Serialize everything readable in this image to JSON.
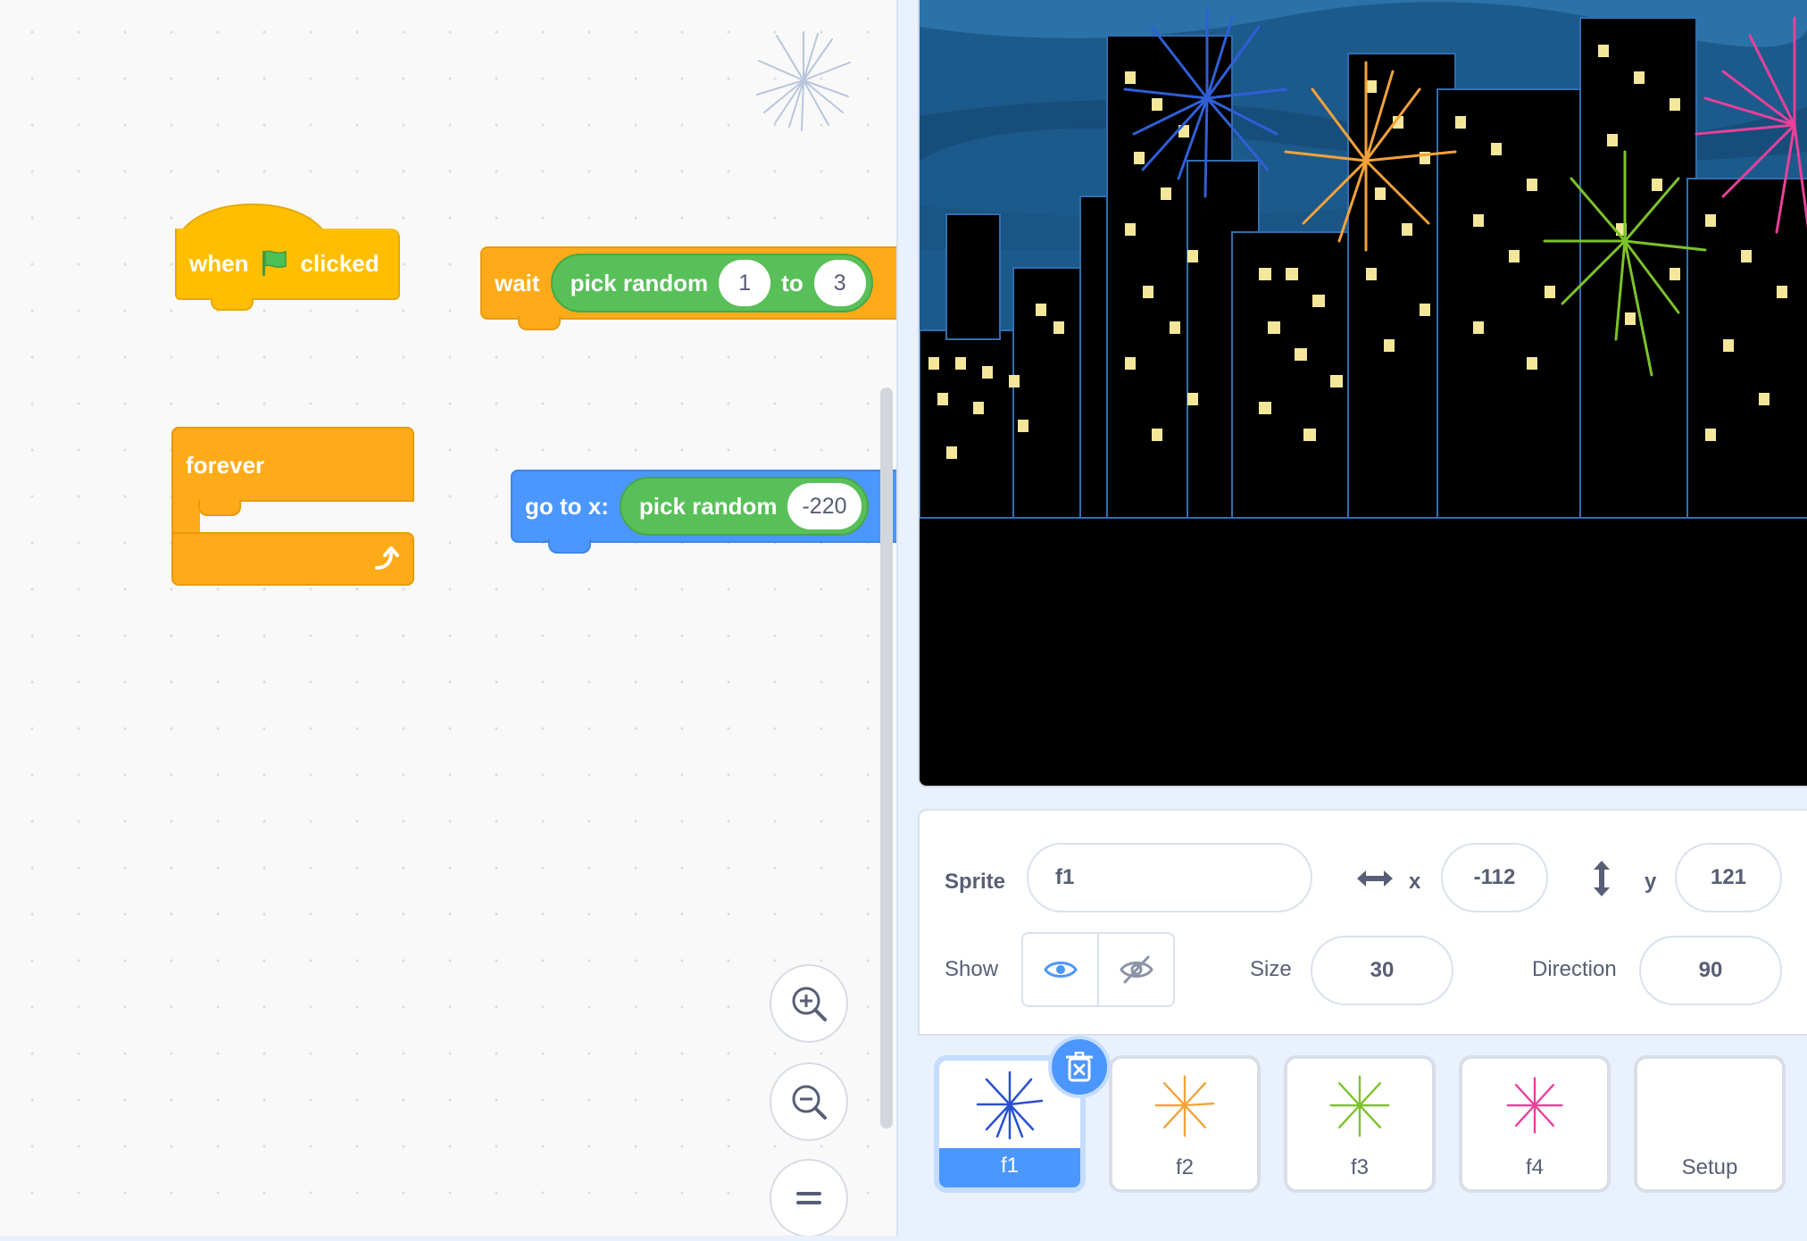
{
  "code_area": {
    "hat_block": {
      "when": "when",
      "clicked": "clicked",
      "icon": "green-flag-icon"
    },
    "wait_block": {
      "label": "wait",
      "reporter_label": "pick random",
      "from_value": "1",
      "to_label": "to",
      "to_value": "3"
    },
    "forever_block": {
      "label": "forever",
      "icon": "loop-arrow-icon"
    },
    "goto_block": {
      "label": "go to x:",
      "reporter_label": "pick random",
      "value": "-220"
    },
    "zoom": {
      "in_icon": "zoom-in-icon",
      "out_icon": "zoom-out-icon",
      "reset_icon": "zoom-reset-icon"
    }
  },
  "sprite_info": {
    "sprite_label": "Sprite",
    "sprite_name": "f1",
    "x_label": "x",
    "x_value": "-112",
    "y_label": "y",
    "y_value": "121",
    "show_label": "Show",
    "size_label": "Size",
    "size_value": "30",
    "direction_label": "Direction",
    "direction_value": "90"
  },
  "sprites": [
    {
      "name": "f1",
      "color": "#2a4fd0",
      "selected": true
    },
    {
      "name": "f2",
      "color": "#f2a23a",
      "selected": false
    },
    {
      "name": "f3",
      "color": "#7cc22a",
      "selected": false
    },
    {
      "name": "f4",
      "color": "#e8409a",
      "selected": false
    },
    {
      "name": "Setup",
      "color": "",
      "selected": false
    }
  ],
  "colors": {
    "events": "#ffbf00",
    "control": "#ffab19",
    "motion": "#4c97ff",
    "operators": "#59c059",
    "accent": "#4c97ff"
  }
}
